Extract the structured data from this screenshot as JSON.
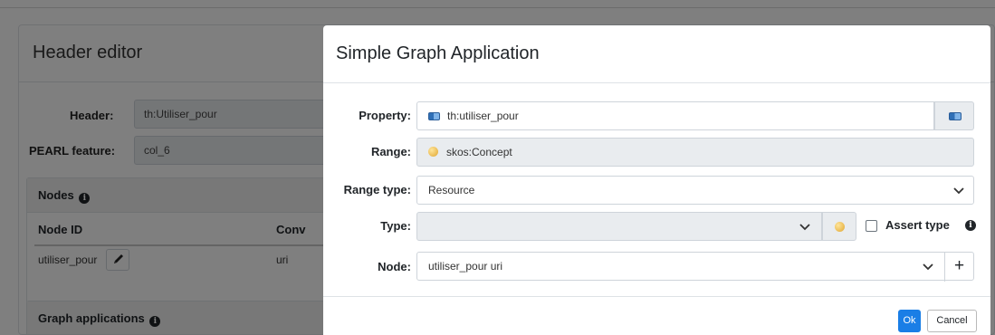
{
  "background": {
    "title": "Header editor",
    "header_label": "Header:",
    "header_value": "th:Utiliser_pour",
    "pearl_label": "PEARL feature:",
    "pearl_value": "col_6",
    "nodes_title": "Nodes",
    "nodes_table": {
      "columns": [
        "Node ID",
        "Conv"
      ],
      "rows": [
        [
          "utiliser_pour",
          "uri"
        ]
      ]
    },
    "graph_apps_title": "Graph applications",
    "icons": [
      "info-icon",
      "pencil-icon"
    ]
  },
  "modal": {
    "title": "Simple Graph Application",
    "property": {
      "label": "Property:",
      "value": "th:utiliser_pour",
      "icon": "property-icon"
    },
    "range": {
      "label": "Range:",
      "value": "skos:Concept",
      "icon": "class-icon"
    },
    "range_type": {
      "label": "Range type:",
      "value": "Resource"
    },
    "type": {
      "label": "Type:",
      "value": "",
      "assert_label": "Assert type",
      "assert_checked": false
    },
    "node": {
      "label": "Node:",
      "value": "utiliser_pour uri",
      "add_icon": "+"
    },
    "ok_label": "Ok",
    "cancel_label": "Cancel"
  },
  "colors": {
    "primary": "#1a7ee6",
    "overlay": "rgba(0,0,0,0.5)",
    "readonly_bg": "#e9ecef"
  }
}
